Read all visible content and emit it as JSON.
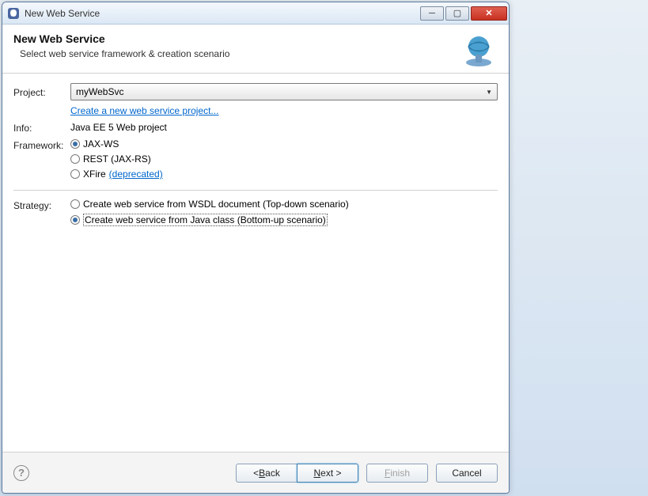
{
  "title": "New Web Service",
  "header": {
    "title": "New Web Service",
    "subtitle": "Select web service framework & creation scenario"
  },
  "labels": {
    "project": "Project:",
    "info": "Info:",
    "framework": "Framework:",
    "strategy": "Strategy:"
  },
  "project": {
    "value": "myWebSvc",
    "createLink": "Create a new web service project..."
  },
  "info": "Java EE 5 Web project",
  "framework": {
    "options": [
      {
        "label": "JAX-WS",
        "checked": true
      },
      {
        "label": "REST (JAX-RS)",
        "checked": false
      },
      {
        "label": "XFire ",
        "checked": false,
        "extraLink": "(deprecated)"
      }
    ]
  },
  "strategy": {
    "options": [
      {
        "label": "Create web service from WSDL document (Top-down scenario)",
        "checked": false
      },
      {
        "label": "Create web service from Java class (Bottom-up scenario)",
        "checked": true
      }
    ]
  },
  "buttons": {
    "back": "< Back",
    "next": "Next >",
    "finish": "Finish",
    "cancel": "Cancel"
  }
}
